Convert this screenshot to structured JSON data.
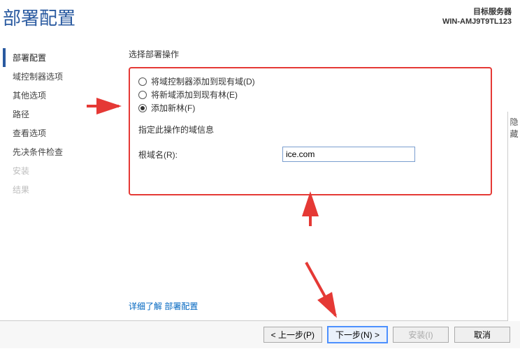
{
  "header": {
    "title": "部署配置",
    "target_label": "目标服务器",
    "target_name": "WIN-AMJ9T9TL123"
  },
  "sidebar": {
    "items": [
      {
        "label": "部署配置",
        "state": "selected"
      },
      {
        "label": "域控制器选项",
        "state": "normal"
      },
      {
        "label": "其他选项",
        "state": "normal"
      },
      {
        "label": "路径",
        "state": "normal"
      },
      {
        "label": "查看选项",
        "state": "normal"
      },
      {
        "label": "先决条件检查",
        "state": "normal"
      },
      {
        "label": "安装",
        "state": "disabled"
      },
      {
        "label": "结果",
        "state": "disabled"
      }
    ]
  },
  "content": {
    "section_label": "选择部署操作",
    "radios": [
      {
        "label": "将域控制器添加到现有域(D)",
        "checked": false
      },
      {
        "label": "将新域添加到现有林(E)",
        "checked": false
      },
      {
        "label": "添加新林(F)",
        "checked": true
      }
    ],
    "domain_info_label": "指定此操作的域信息",
    "root_domain_label": "根域名(R):",
    "root_domain_value": "ice.com",
    "learn_more": "详细了解 部署配置",
    "hidden_strip": "隐藏"
  },
  "buttons": {
    "prev": "< 上一步(P)",
    "next": "下一步(N) >",
    "install": "安装(I)",
    "cancel": "取消"
  }
}
